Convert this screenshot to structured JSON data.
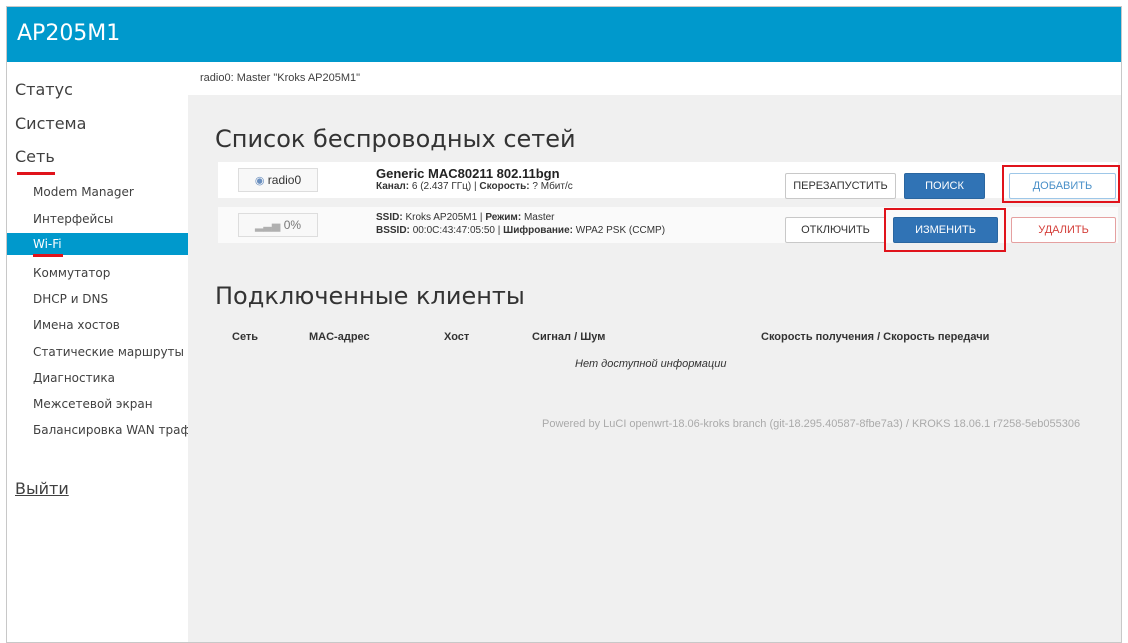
{
  "header": {
    "brand": "AP205M1"
  },
  "sidebar": {
    "top": [
      "Статус",
      "Система",
      "Сеть"
    ],
    "sub": [
      "Modem Manager",
      "Интерфейсы",
      "Wi-Fi",
      "Коммутатор",
      "DHCP и DNS",
      "Имена хостов",
      "Статические маршруты",
      "Диагностика",
      "Межсетевой экран",
      "Балансировка WAN трафик"
    ],
    "logout": "Выйти"
  },
  "breadcrumb": "radio0: Master \"Kroks AP205M1\"",
  "wifi": {
    "title": "Список беспроводных сетей",
    "radio": {
      "chip": "radio0",
      "name": "Generic MAC80211 802.11bgn",
      "channel_label": "Канал:",
      "channel_value": "6 (2.437 ГГц) |",
      "speed_label": "Скорость:",
      "speed_value": "? Мбит/с",
      "buttons": {
        "restart": "ПЕРЕЗАПУСТИТЬ",
        "scan": "ПОИСК",
        "add": "ДОБАВИТЬ"
      }
    },
    "network": {
      "chip": "0%",
      "ssid_label": "SSID:",
      "ssid_value": "Kroks AP205M1 |",
      "mode_label": "Режим:",
      "mode_value": "Master",
      "bssid_label": "BSSID:",
      "bssid_value": "00:0C:43:47:05:50 |",
      "enc_label": "Шифрование:",
      "enc_value": "WPA2 PSK (CCMP)",
      "buttons": {
        "disable": "ОТКЛЮЧИТЬ",
        "edit": "ИЗМЕНИТЬ",
        "remove": "УДАЛИТЬ"
      }
    }
  },
  "clients": {
    "title": "Подключенные клиенты",
    "columns": [
      "Сеть",
      "MAC-адрес",
      "Хост",
      "Сигнал / Шум",
      "Скорость получения / Скорость передачи"
    ],
    "empty": "Нет доступной информации"
  },
  "footer": "Powered by LuCI openwrt-18.06-kroks branch (git-18.295.40587-8fbe7a3) / KROKS 18.06.1 r7258-5eb055306",
  "colors": {
    "accent": "#0099cc",
    "highlight": "#e0131b",
    "primary_button": "#3073b5"
  },
  "icons": {
    "radio": "wifi-radio-icon",
    "signal": "signal-bars-icon"
  }
}
